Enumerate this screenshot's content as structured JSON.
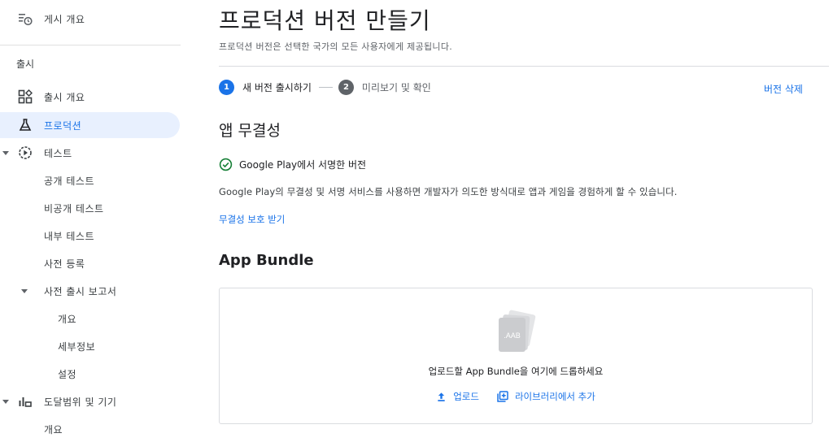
{
  "sidebar": {
    "release_overview": "게시 개요",
    "section_release": "출시",
    "items": {
      "overview": "출시 개요",
      "production": "프로덕션",
      "testing": "테스트",
      "open_testing": "공개 테스트",
      "closed_testing": "비공개 테스트",
      "internal_testing": "내부 테스트",
      "pre_registration": "사전 등록",
      "pre_launch_report": "사전 출시 보고서",
      "prl_overview": "개요",
      "prl_details": "세부정보",
      "prl_settings": "설정",
      "reach_devices": "도달범위 및 기기",
      "reach_overview": "개요"
    }
  },
  "main": {
    "title": "프로덕션 버전 만들기",
    "subtitle": "프로덕션 버전은 선택한 국가의 모든 사용자에게 제공됩니다.",
    "stepper": {
      "step1_num": "1",
      "step1_label": "새 버전 출시하기",
      "step2_num": "2",
      "step2_label": "미리보기 및 확인"
    },
    "delete_release": "버전 삭제",
    "integrity": {
      "heading": "앱 무결성",
      "signed_label": "Google Play에서 서명한 버전",
      "description": "Google Play의 무결성 및 서명 서비스를 사용하면 개발자가 의도한 방식대로 앱과 게임을 경험하게 할 수 있습니다.",
      "protect_link": "무결성 보호 받기"
    },
    "bundle": {
      "heading": "App Bundle",
      "file_label": ".AAB",
      "drop_text": "업로드할 App Bundle을 여기에 드롭하세요",
      "upload_label": "업로드",
      "add_from_library_label": "라이브러리에서 추가"
    }
  },
  "colors": {
    "accent": "#1a73e8",
    "active_nav_bg": "#e8f0fe",
    "success": "#188038",
    "step_inactive": "#5f6368"
  },
  "icons": {
    "release_overview": "clock-list-icon",
    "releases_overview": "dashboard-icon",
    "production": "flask-icon",
    "testing": "play-circle-icon",
    "reach": "bar-chart-icon",
    "signed": "check-circle-icon",
    "upload": "upload-icon",
    "library": "add-box-icon"
  }
}
